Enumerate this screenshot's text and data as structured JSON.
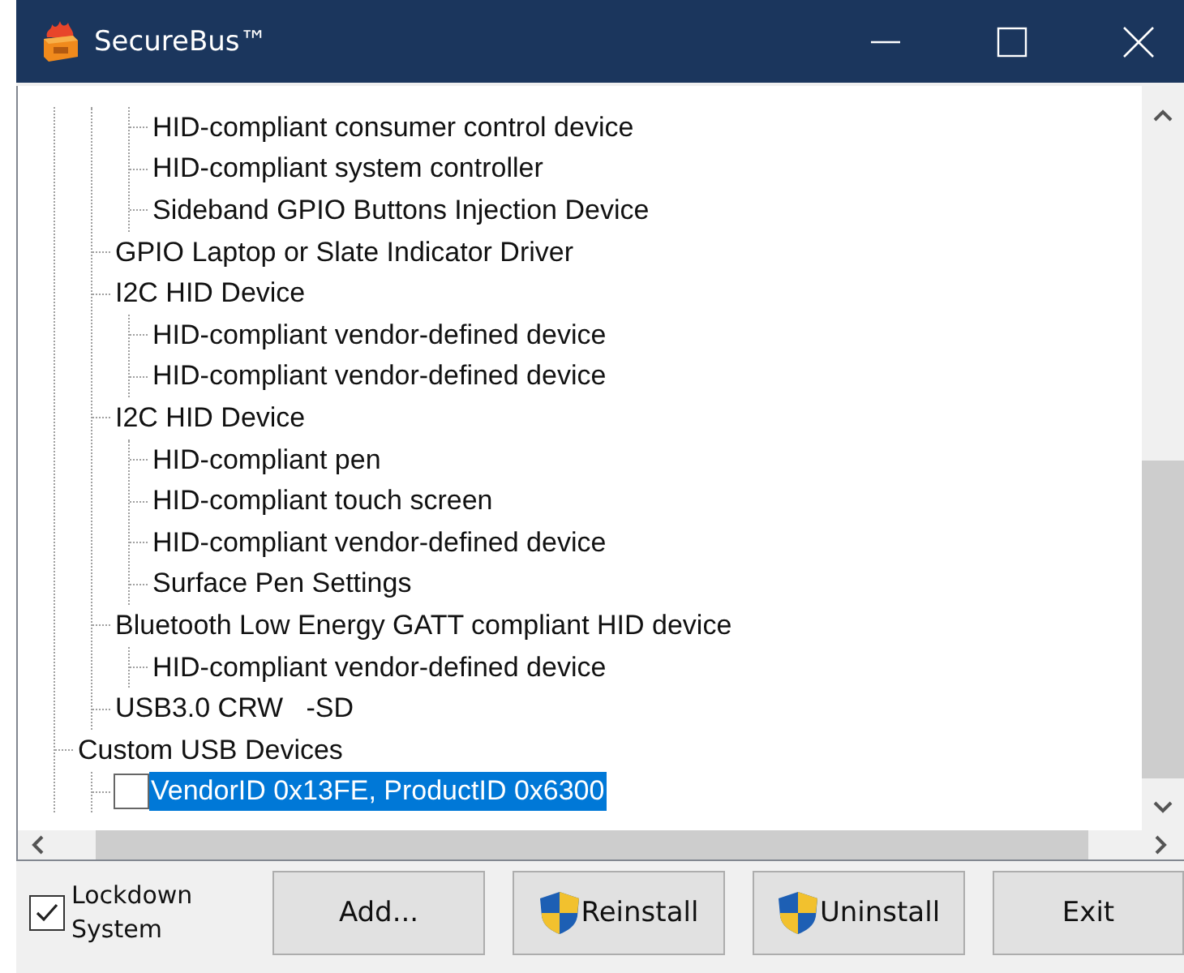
{
  "window": {
    "title": "SecureBus™"
  },
  "tree": [
    {
      "children": [
        {
          "children": [
            {
              "label": "HID-compliant consumer control device",
              "selected": false
            },
            {
              "label": "HID-compliant system controller",
              "selected": false
            },
            {
              "label": "Sideband GPIO Buttons Injection Device",
              "selected": false
            }
          ]
        },
        {
          "label": "GPIO Laptop or Slate Indicator Driver",
          "selected": false
        },
        {
          "label": "I2C HID Device",
          "selected": false,
          "children": [
            {
              "label": "HID-compliant vendor-defined device",
              "selected": false
            },
            {
              "label": "HID-compliant vendor-defined device",
              "selected": false
            }
          ]
        },
        {
          "label": "I2C HID Device",
          "selected": false,
          "children": [
            {
              "label": "HID-compliant pen",
              "selected": false
            },
            {
              "label": "HID-compliant touch screen",
              "selected": false
            },
            {
              "label": "HID-compliant vendor-defined device",
              "selected": false
            },
            {
              "label": "Surface Pen Settings",
              "selected": false
            }
          ]
        },
        {
          "label": "Bluetooth Low Energy GATT compliant HID device",
          "selected": false,
          "children": [
            {
              "label": "HID-compliant vendor-defined device",
              "selected": false
            }
          ]
        },
        {
          "label": "USB3.0 CRW   -SD",
          "selected": false
        }
      ]
    },
    {
      "label": "Custom USB Devices",
      "selected": false,
      "children": [
        {
          "label": "VendorID 0x13FE, ProductID 0x6300",
          "selected": true,
          "checked": false
        }
      ]
    }
  ],
  "lockdown": {
    "label": "Lockdown System",
    "checked": true
  },
  "buttons": [
    {
      "label": "Add...",
      "shield": false
    },
    {
      "label": "Reinstall",
      "shield": true
    },
    {
      "label": "Uninstall",
      "shield": true
    },
    {
      "label": "Exit",
      "shield": false
    }
  ]
}
